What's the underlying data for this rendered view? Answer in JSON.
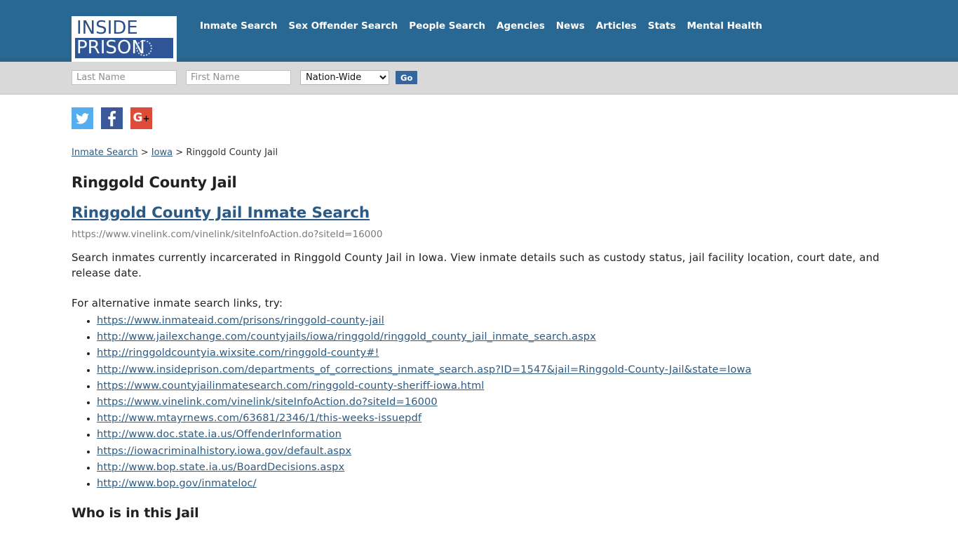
{
  "header": {
    "logo": {
      "line1": "INSIDE",
      "line2": "PRISON",
      "ring_icon": "chain-ring-icon"
    },
    "nav": [
      {
        "label": "Inmate Search"
      },
      {
        "label": "Sex Offender Search"
      },
      {
        "label": "People Search"
      },
      {
        "label": "Agencies"
      },
      {
        "label": "News"
      },
      {
        "label": "Articles"
      },
      {
        "label": "Stats"
      },
      {
        "label": "Mental Health"
      }
    ],
    "bg_color": "#2a6894"
  },
  "search": {
    "last_name_placeholder": "Last Name",
    "last_name_value": "",
    "first_name_placeholder": "First Name",
    "first_name_value": "",
    "scope_selected": "Nation-Wide",
    "scope_options": [
      "Nation-Wide"
    ],
    "go_label": "Go",
    "go_color": "#35679f"
  },
  "social": [
    {
      "name": "twitter",
      "color": "#55acee"
    },
    {
      "name": "facebook",
      "color": "#3b5998"
    },
    {
      "name": "googleplus",
      "color": "#dd4b39",
      "glyph": "G",
      "plus": "+"
    }
  ],
  "breadcrumb": {
    "item1": "Inmate Search",
    "sep1": " > ",
    "item2": "Iowa",
    "sep2": " > ",
    "current": "Ringgold County Jail"
  },
  "page": {
    "title": "Ringgold County Jail",
    "main_link": "Ringgold County Jail Inmate Search",
    "main_url": "https://www.vinelink.com/vinelink/siteInfoAction.do?siteId=16000",
    "description": "Search inmates currently incarcerated in Ringgold County Jail in Iowa. View inmate details such as custody status, jail facility location, court date, and release date.",
    "alt_intro": "For alternative inmate search links, try:",
    "alt_links": [
      "https://www.inmateaid.com/prisons/ringgold-county-jail",
      "http://www.jailexchange.com/countyjails/iowa/ringgold/ringgold_county_jail_inmate_search.aspx",
      "http://ringgoldcountyia.wixsite.com/ringgold-county#!",
      "http://www.insideprison.com/departments_of_corrections_inmate_search.asp?ID=1547&jail=Ringgold-County-Jail&state=Iowa",
      "https://www.countyjailinmatesearch.com/ringgold-county-sheriff-iowa.html",
      "https://www.vinelink.com/vinelink/siteInfoAction.do?siteId=16000",
      "http://www.mtayrnews.com/63681/2346/1/this-weeks-issuepdf",
      "http://www.doc.state.ia.us/OffenderInformation",
      "https://iowacriminalhistory.iowa.gov/default.aspx",
      "http://www.bop.state.ia.us/BoardDecisions.aspx",
      "http://www.bop.gov/inmateloc/"
    ],
    "section_title": "Who is in this Jail"
  }
}
